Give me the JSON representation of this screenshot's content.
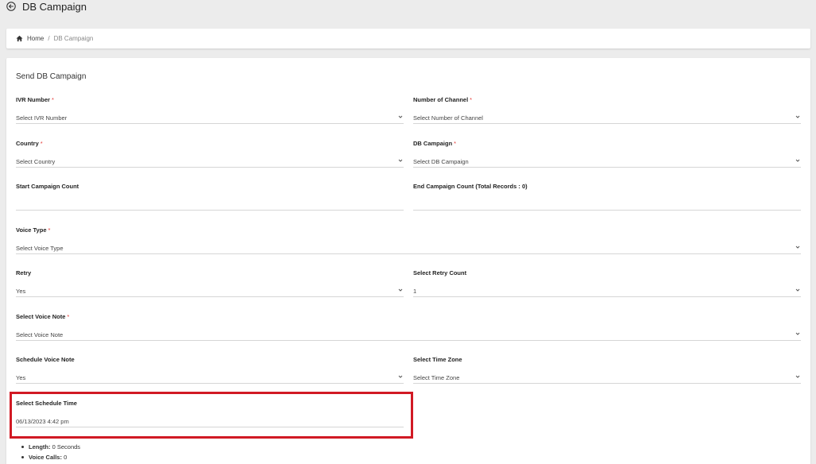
{
  "header": {
    "title": "DB Campaign",
    "back_icon": "arrow-left-circle-icon"
  },
  "breadcrumb": {
    "home_icon": "home-icon",
    "home": "Home",
    "separator": "/",
    "current": "DB Campaign"
  },
  "form": {
    "title": "Send DB Campaign",
    "required_marker": "*",
    "ivr_number": {
      "label": "IVR Number",
      "value": "Select IVR Number"
    },
    "number_of_channel": {
      "label": "Number of Channel",
      "value": "Select Number of Channel"
    },
    "country": {
      "label": "Country",
      "value": "Select Country"
    },
    "db_campaign": {
      "label": "DB Campaign",
      "value": "Select DB Campaign"
    },
    "start_campaign_count": {
      "label": "Start Campaign Count",
      "value": ""
    },
    "end_campaign_count": {
      "label": "End Campaign Count (Total Records : 0)",
      "value": ""
    },
    "voice_type": {
      "label": "Voice Type",
      "value": "Select Voice Type"
    },
    "retry": {
      "label": "Retry",
      "value": "Yes"
    },
    "retry_count": {
      "label": "Select Retry Count",
      "value": "1"
    },
    "voice_note": {
      "label": "Select Voice Note",
      "value": "Select Voice Note"
    },
    "schedule_voice_note": {
      "label": "Schedule Voice Note",
      "value": "Yes"
    },
    "time_zone": {
      "label": "Select Time Zone",
      "value": "Select Time Zone"
    },
    "schedule_time": {
      "label": "Select Schedule Time",
      "value": "06/13/2023 4:42 pm"
    }
  },
  "summary": [
    {
      "key": "Length:",
      "value": "0 Seconds"
    },
    {
      "key": "Voice Calls:",
      "value": "0"
    }
  ],
  "colors": {
    "highlight": "#d11a24",
    "required": "#e53935",
    "background": "#ececec"
  }
}
